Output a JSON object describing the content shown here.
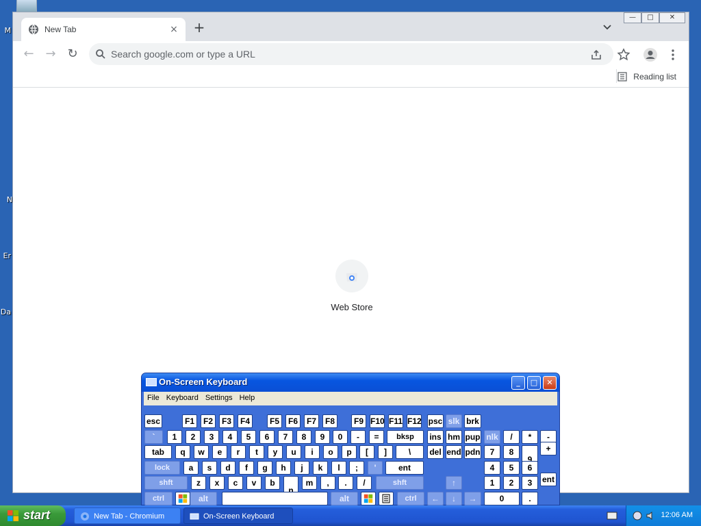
{
  "desktop": {
    "icons": [
      "M",
      "N",
      "Er",
      "Da"
    ]
  },
  "browser": {
    "tab_title": "New Tab",
    "tab_close": "×",
    "new_tab": "+",
    "window_controls": [
      "—",
      "□",
      "✕"
    ],
    "omnibox_placeholder": "Search google.com or type a URL",
    "reading_list": "Reading list",
    "tile_label": "Web Store"
  },
  "osk": {
    "title": "On-Screen Keyboard",
    "menu": [
      "File",
      "Keyboard",
      "Settings",
      "Help"
    ],
    "buttons": {
      "minimize": "_",
      "maximize": "□",
      "close": "✕"
    },
    "keys": [
      "esc",
      "F1",
      "F2",
      "F3",
      "F4",
      "F5",
      "F6",
      "F7",
      "F8",
      "F9",
      "F10",
      "F11",
      "F12",
      "psc",
      "slk",
      "brk",
      "`",
      "1",
      "2",
      "3",
      "4",
      "5",
      "6",
      "7",
      "8",
      "9",
      "0",
      "-",
      "=",
      "bksp",
      "ins",
      "hm",
      "pup",
      "nlk",
      "/",
      "*",
      "-",
      "tab",
      "q",
      "w",
      "e",
      "r",
      "t",
      "y",
      "u",
      "i",
      "o",
      "p",
      "[",
      "]",
      "\\",
      "del",
      "end",
      "pdn",
      "7",
      "8",
      "9",
      "+",
      "lock",
      "a",
      "s",
      "d",
      "f",
      "g",
      "h",
      "j",
      "k",
      "l",
      ";",
      "'",
      "ent",
      "4",
      "5",
      "6",
      "shft",
      "z",
      "x",
      "c",
      "v",
      "b",
      "n",
      "m",
      ",",
      ".",
      "/",
      "shft",
      "↑",
      "1",
      "2",
      "3",
      "ent",
      "ctrl",
      "alt",
      "alt",
      "ctrl",
      "←",
      "↓",
      "→",
      "0",
      "."
    ]
  },
  "taskbar": {
    "start": "start",
    "items": [
      "New Tab - Chromium",
      "On-Screen Keyboard"
    ],
    "clock": "12:06 AM"
  }
}
